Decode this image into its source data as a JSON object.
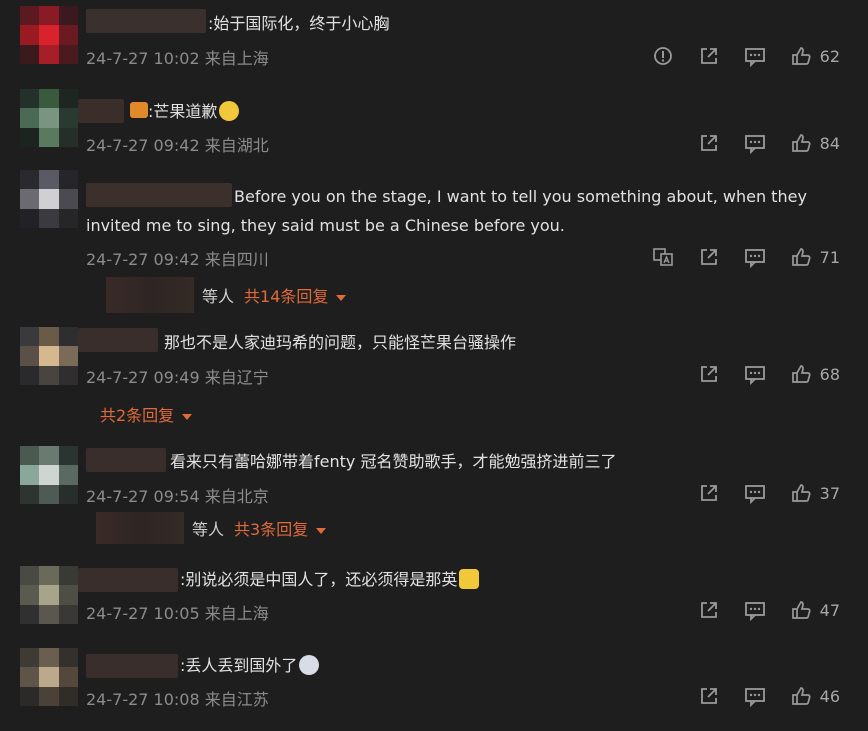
{
  "comments": [
    {
      "text": ":始于国际化，终于小心胸",
      "meta": "24-7-27 10:02 来自上海",
      "likes": "62",
      "report": true
    },
    {
      "text": ":芒果道歉",
      "meta": "24-7-27 09:42 来自湖北",
      "likes": "84"
    },
    {
      "text": "Before you on the stage, I want to tell you something about, when they invited me to sing, they said must be a Chinese before you.",
      "meta": "24-7-27 09:42 来自四川",
      "likes": "71",
      "translate": true,
      "replies": {
        "who": "等人",
        "more": "共14条回复"
      }
    },
    {
      "text": "那也不是人家迪玛希的问题，只能怪芒果台骚操作",
      "meta": "24-7-27 09:49 来自辽宁",
      "likes": "68",
      "replies": {
        "who": "",
        "more": "共2条回复"
      }
    },
    {
      "text": "看来只有蕾哈娜带着fenty 冠名赞助歌手，才能勉强挤进前三了",
      "meta": "24-7-27 09:54 来自北京",
      "likes": "37",
      "replies": {
        "who": "等人",
        "more": "共3条回复"
      }
    },
    {
      "text": ":别说必须是中国人了，还必须得是那英",
      "meta": "24-7-27 10:05 来自上海",
      "likes": "47"
    },
    {
      "text": ":丢人丢到国外了",
      "meta": "24-7-27 10:08 来自江苏",
      "likes": "46"
    }
  ],
  "icons": {
    "report": "report-icon",
    "share": "share-icon",
    "comment": "comment-icon",
    "like": "like-icon",
    "translate": "translate-icon"
  },
  "colors": {
    "background": "#1e1e1e",
    "accent": "#e06a3a",
    "meta": "#8c8c8c"
  }
}
